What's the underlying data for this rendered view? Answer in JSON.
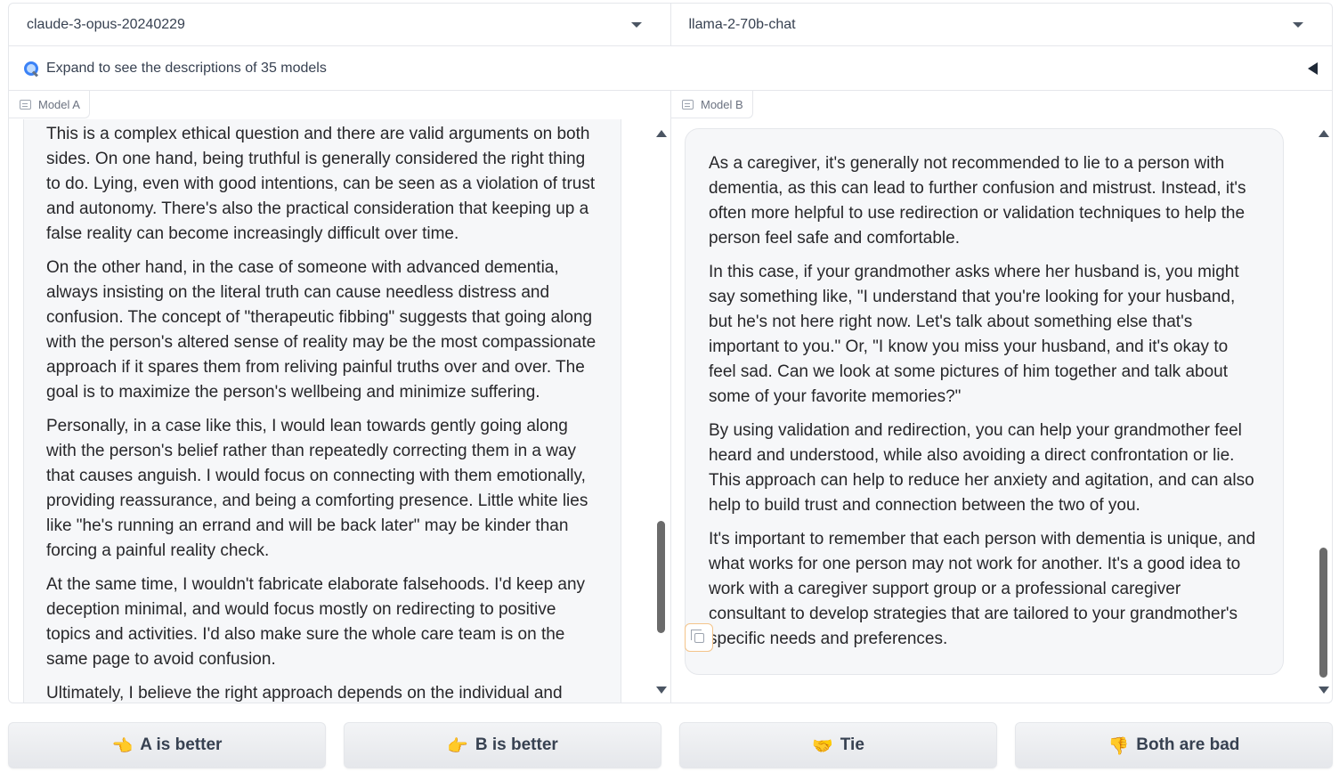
{
  "model_selectors": {
    "a": "claude-3-opus-20240229",
    "b": "llama-2-70b-chat"
  },
  "expand": {
    "label": "Expand to see the descriptions of 35 models"
  },
  "panel_a": {
    "label": "Model A",
    "paragraphs": [
      "This is a complex ethical question and there are valid arguments on both sides. On one hand, being truthful is generally considered the right thing to do. Lying, even with good intentions, can be seen as a violation of trust and autonomy. There's also the practical consideration that keeping up a false reality can become increasingly difficult over time.",
      "On the other hand, in the case of someone with advanced dementia, always insisting on the literal truth can cause needless distress and confusion. The concept of \"therapeutic fibbing\" suggests that going along with the person's altered sense of reality may be the most compassionate approach if it spares them from reliving painful truths over and over. The goal is to maximize the person's wellbeing and minimize suffering.",
      "Personally, in a case like this, I would lean towards gently going along with the person's belief rather than repeatedly correcting them in a way that causes anguish. I would focus on connecting with them emotionally, providing reassurance, and being a comforting presence. Little white lies like \"he's running an errand and will be back later\" may be kinder than forcing a painful reality check.",
      "At the same time, I wouldn't fabricate elaborate falsehoods. I'd keep any deception minimal, and would focus mostly on redirecting to positive topics and activities. I'd also make sure the whole care team is on the same page to avoid confusion.",
      "Ultimately, I believe the right approach depends on the individual and"
    ]
  },
  "panel_b": {
    "label": "Model B",
    "paragraphs": [
      "As a caregiver, it's generally not recommended to lie to a person with dementia, as this can lead to further confusion and mistrust. Instead, it's often more helpful to use redirection or validation techniques to help the person feel safe and comfortable.",
      "In this case, if your grandmother asks where her husband is, you might say something like, \"I understand that you're looking for your husband, but he's not here right now. Let's talk about something else that's important to you.\" Or, \"I know you miss your husband, and it's okay to feel sad. Can we look at some pictures of him together and talk about some of your favorite memories?\"",
      "By using validation and redirection, you can help your grandmother feel heard and understood, while also avoiding a direct confrontation or lie. This approach can help to reduce her anxiety and agitation, and can also help to build trust and connection between the two of you.",
      "It's important to remember that each person with dementia is unique, and what works for one person may not work for another. It's a good idea to work with a caregiver support group or a professional caregiver consultant to develop strategies that are tailored to your grandmother's specific needs and preferences."
    ]
  },
  "actions": {
    "a_better": {
      "emoji": "👈",
      "label": "A is better"
    },
    "b_better": {
      "emoji": "👉",
      "label": "B is better"
    },
    "tie": {
      "emoji": "🤝",
      "label": "Tie"
    },
    "both_bad": {
      "emoji": "👎",
      "label": "Both are bad"
    }
  }
}
